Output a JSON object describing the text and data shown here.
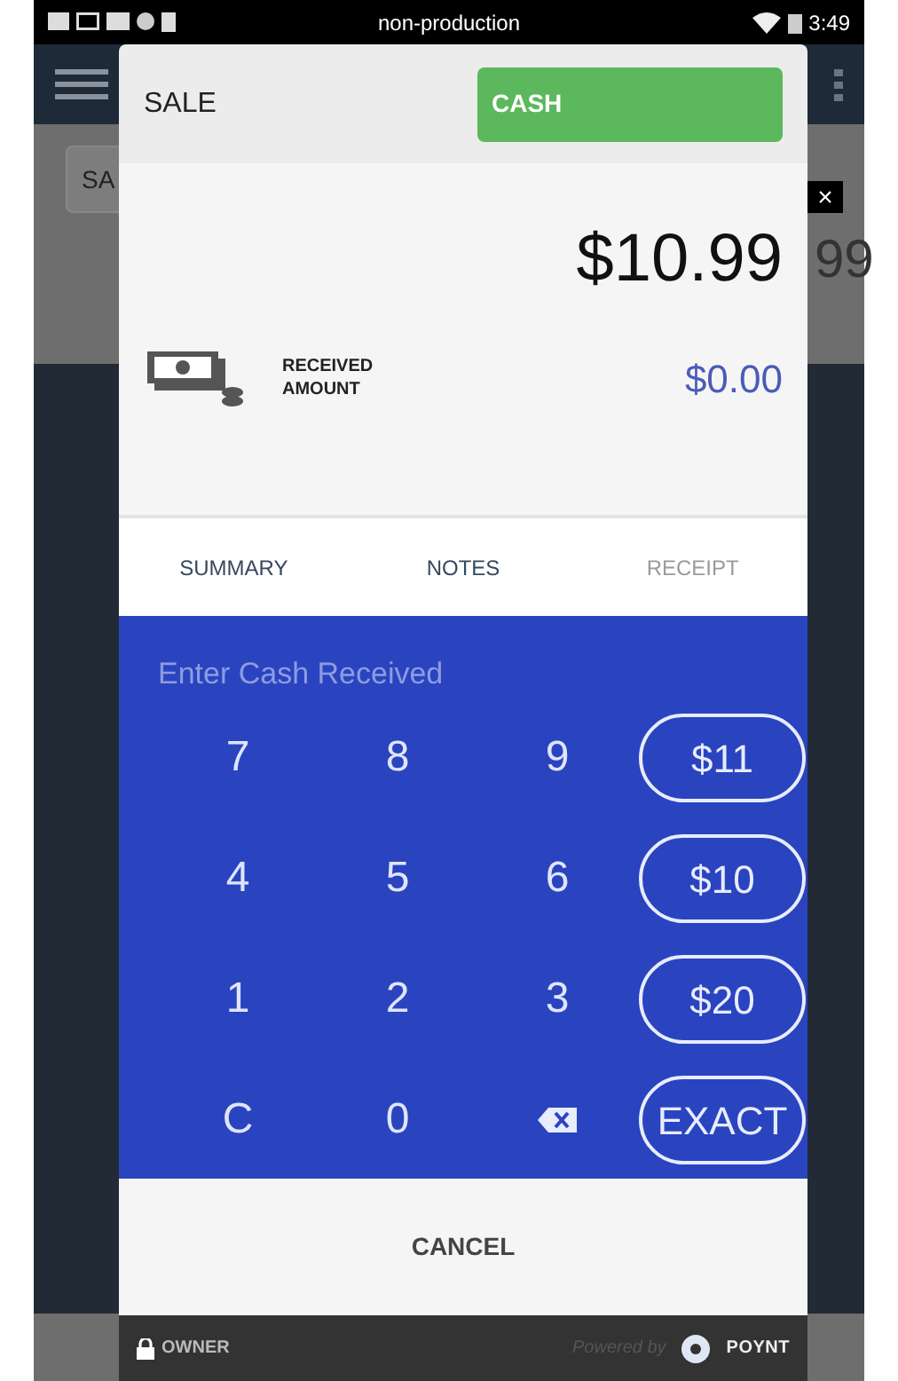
{
  "status_bar": {
    "title": "non-production",
    "time": "3:49"
  },
  "background": {
    "button_text": "SA",
    "amount_text": "99",
    "close": "×"
  },
  "dialog": {
    "title": "SALE",
    "method_button": "CASH",
    "total": "$10.99",
    "received_label": "RECEIVED AMOUNT",
    "received_amount": "$0.00",
    "tabs": [
      {
        "label": "SUMMARY",
        "disabled": false
      },
      {
        "label": "NOTES",
        "disabled": false
      },
      {
        "label": "RECEIPT",
        "disabled": true
      }
    ],
    "keypad_prompt": "Enter Cash Received",
    "keys": [
      {
        "kind": "digit",
        "label": "7"
      },
      {
        "kind": "digit",
        "label": "8"
      },
      {
        "kind": "digit",
        "label": "9"
      },
      {
        "kind": "quick",
        "label": "$11"
      },
      {
        "kind": "digit",
        "label": "4"
      },
      {
        "kind": "digit",
        "label": "5"
      },
      {
        "kind": "digit",
        "label": "6"
      },
      {
        "kind": "quick",
        "label": "$10"
      },
      {
        "kind": "digit",
        "label": "1"
      },
      {
        "kind": "digit",
        "label": "2"
      },
      {
        "kind": "digit",
        "label": "3"
      },
      {
        "kind": "quick",
        "label": "$20"
      },
      {
        "kind": "digit",
        "label": "C"
      },
      {
        "kind": "digit",
        "label": "0"
      },
      {
        "kind": "backspace"
      },
      {
        "kind": "quick",
        "label": "EXACT"
      }
    ],
    "cancel_button": "CANCEL"
  },
  "footer": {
    "user": "OWNER",
    "powered_by": "Powered by",
    "brand": "POYNT"
  }
}
